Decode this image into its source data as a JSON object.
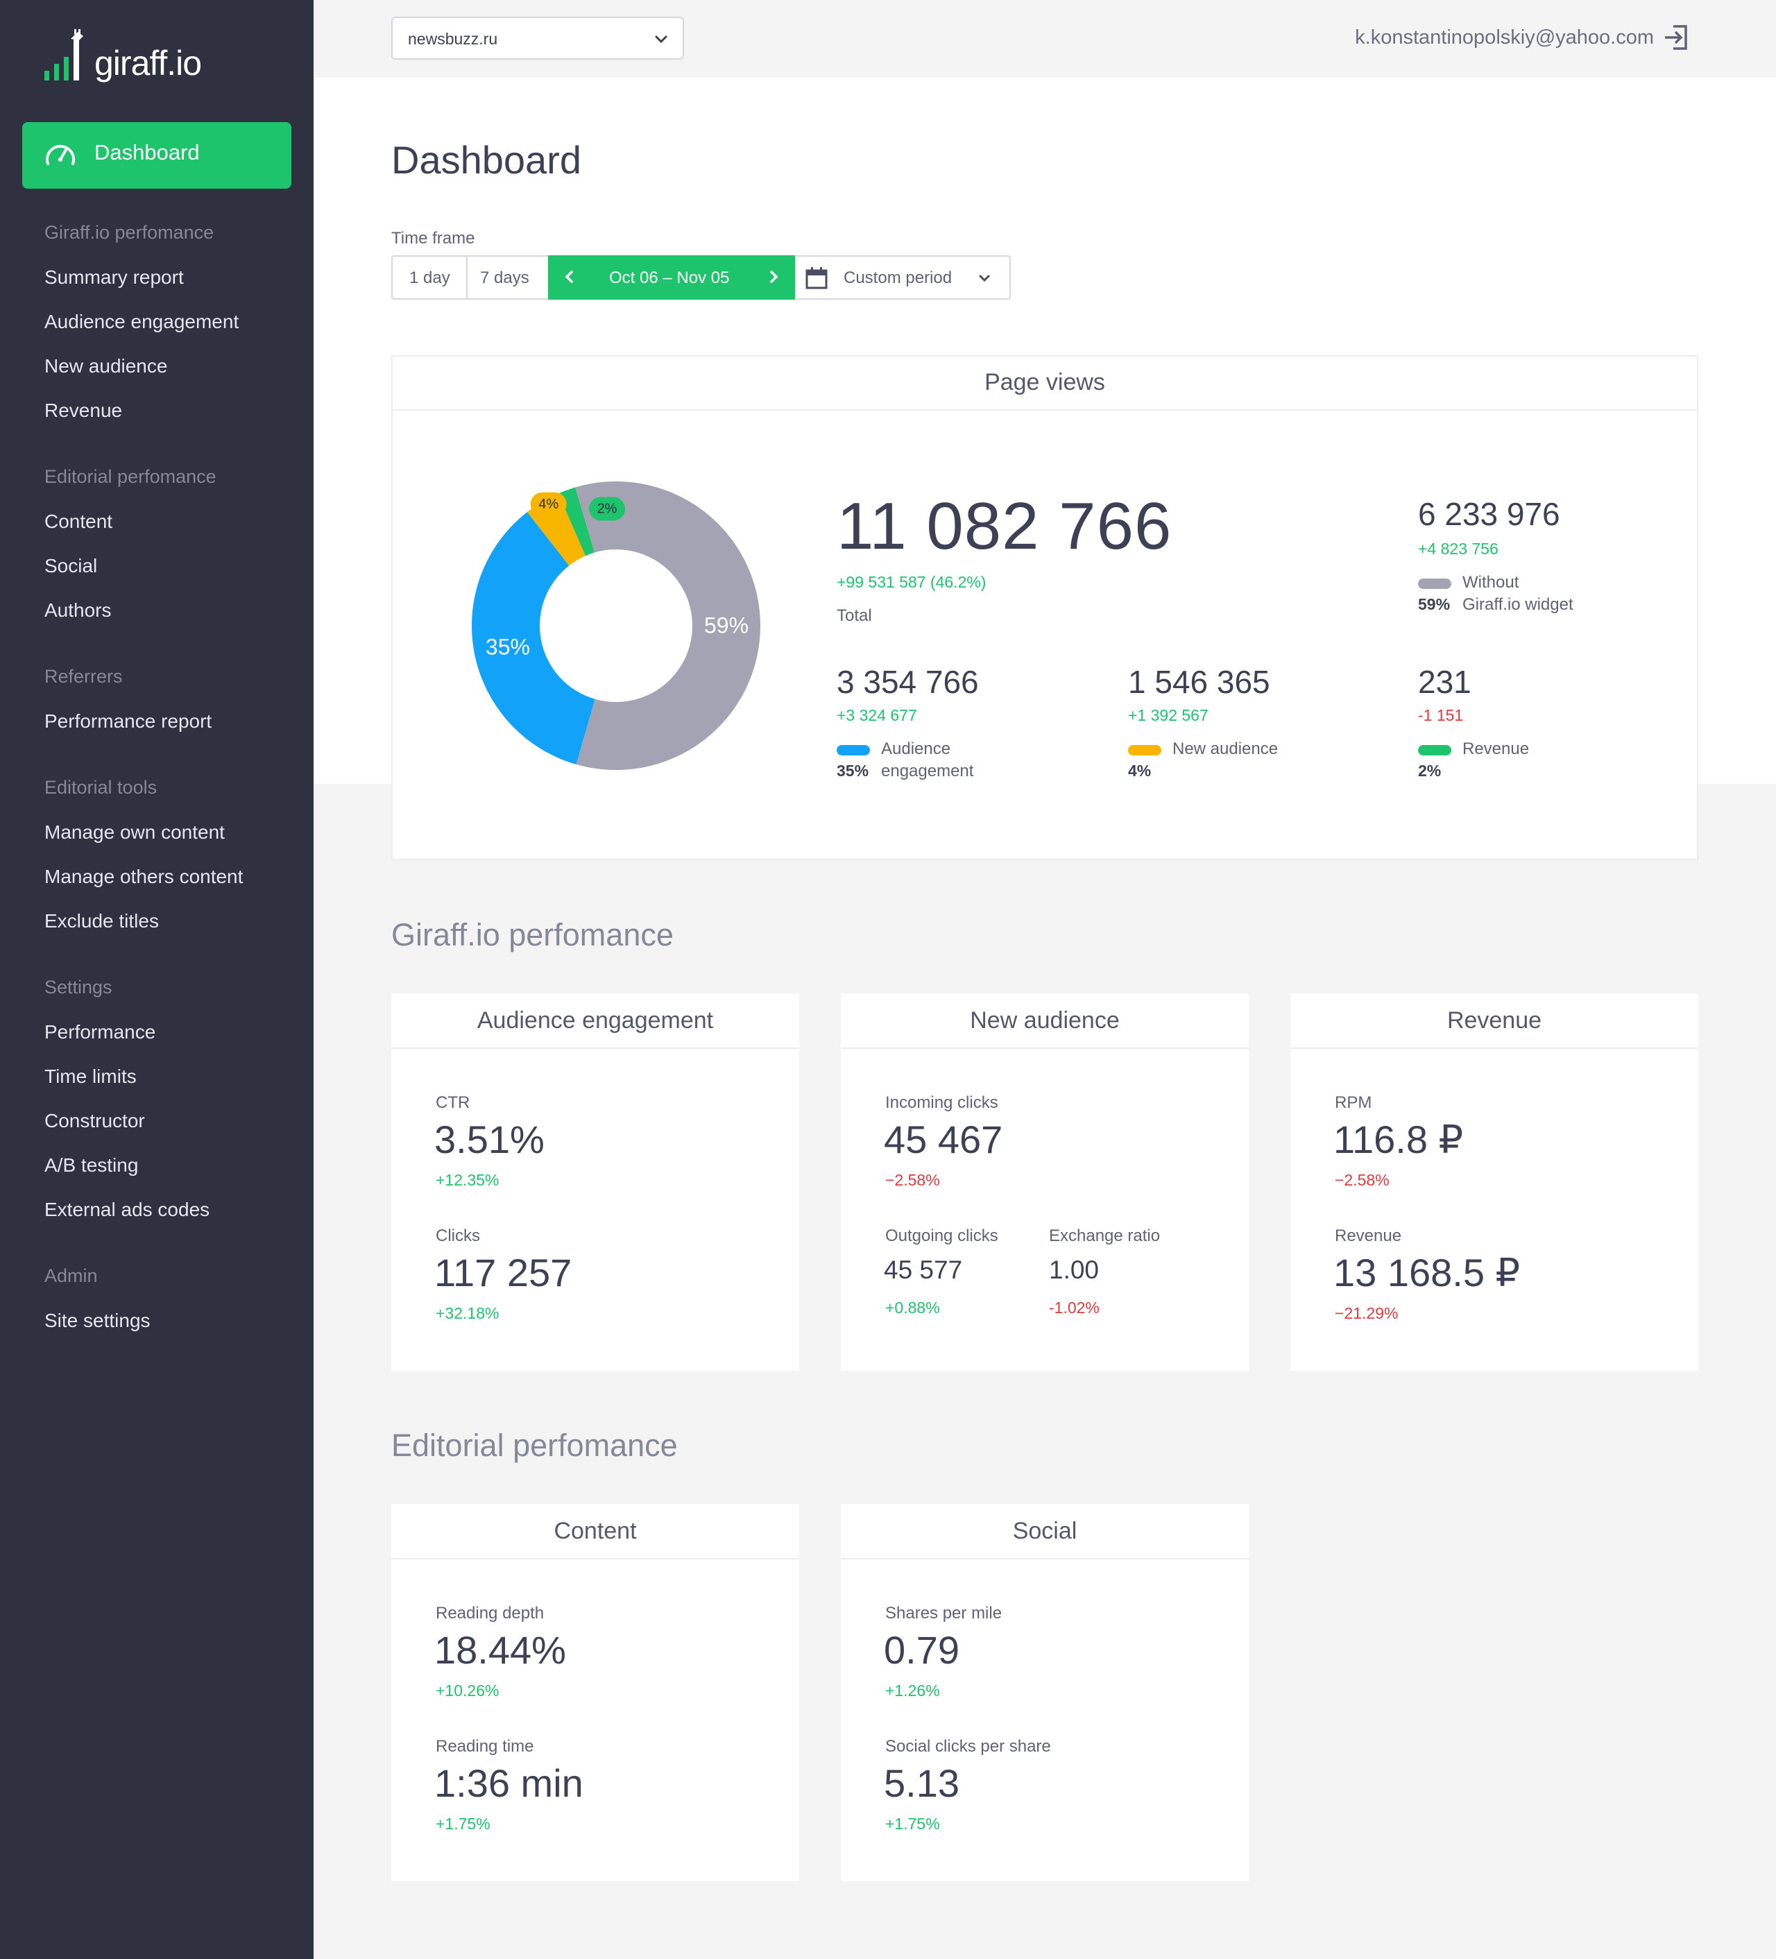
{
  "brand": {
    "name": "giraff.io"
  },
  "sidebar": {
    "dashboard_label": "Dashboard",
    "sections": [
      {
        "title": "Giraff.io perfomance",
        "items": [
          "Summary report",
          "Audience engagement",
          "New audience",
          "Revenue"
        ]
      },
      {
        "title": "Editorial perfomance",
        "items": [
          "Content",
          "Social",
          "Authors"
        ]
      },
      {
        "title": "Referrers",
        "items": [
          "Performance report"
        ]
      },
      {
        "title": "Editorial tools",
        "items": [
          "Manage own content",
          "Manage others content",
          "Exclude titles"
        ]
      },
      {
        "title": "Settings",
        "items": [
          "Performance",
          "Time limits",
          "Constructor",
          "A/B testing",
          "External ads codes"
        ]
      },
      {
        "title": "Admin",
        "items": [
          "Site settings"
        ]
      }
    ]
  },
  "topbar": {
    "site_select": "newsbuzz.ru",
    "user_email": "k.konstantinopolskiy@yahoo.com"
  },
  "page": {
    "title": "Dashboard"
  },
  "timeframe": {
    "label": "Time frame",
    "one_day": "1 day",
    "seven_days": "7 days",
    "range": "Oct 06 – Nov 05",
    "custom": "Custom period"
  },
  "page_views": {
    "title": "Page views",
    "total": "11 082 766",
    "total_delta": "+99 531 587 (46.2%)",
    "total_label": "Total",
    "without": {
      "value": "6 233 976",
      "delta": "+4 823 756",
      "label1": "Without",
      "label2": "Giraff.io widget",
      "pct": "59%"
    },
    "engagement": {
      "value": "3 354 766",
      "delta": "+3 324 677",
      "label1": "Audience",
      "label2": "engagement",
      "pct": "35%"
    },
    "new_audience": {
      "value": "1 546 365",
      "delta": "+1 392 567",
      "label1": "New audience",
      "pct": "4%"
    },
    "revenue": {
      "value": "231",
      "delta": "-1 151",
      "label1": "Revenue",
      "pct": "2%"
    }
  },
  "chart_data": {
    "type": "pie",
    "categories": [
      "Audience engagement",
      "New audience",
      "Revenue",
      "Without Giraff.io widget"
    ],
    "values": [
      35,
      4,
      2,
      59
    ],
    "labels": [
      "35%",
      "4%",
      "2%",
      "59%"
    ],
    "colors": [
      "#12a2f7",
      "#f7b500",
      "#1ec46c",
      "#a3a3b3"
    ]
  },
  "sections": {
    "giraff_title": "Giraff.io perfomance",
    "editorial_title": "Editorial perfomance"
  },
  "cards": {
    "audience": {
      "title": "Audience engagement",
      "m1_label": "CTR",
      "m1_value": "3.51%",
      "m1_delta": "+12.35%",
      "m2_label": "Clicks",
      "m2_value": "117 257",
      "m2_delta": "+32.18%"
    },
    "new_audience": {
      "title": "New audience",
      "m1_label": "Incoming clicks",
      "m1_value": "45 467",
      "m1_delta": "−2.58%",
      "m2_label": "Outgoing clicks",
      "m2_value": "45 577",
      "m2_delta": "+0.88%",
      "m3_label": "Exchange ratio",
      "m3_value": "1.00",
      "m3_delta": "-1.02%"
    },
    "revenue": {
      "title": "Revenue",
      "m1_label": "RPM",
      "m1_value": "116.8 ₽",
      "m1_delta": "−2.58%",
      "m2_label": "Revenue",
      "m2_value": "13 168.5 ₽",
      "m2_delta": "−21.29%"
    },
    "content": {
      "title": "Content",
      "m1_label": "Reading depth",
      "m1_value": "18.44%",
      "m1_delta": "+10.26%",
      "m2_label": "Reading time",
      "m2_value": "1:36 min",
      "m2_delta": "+1.75%"
    },
    "social": {
      "title": "Social",
      "m1_label": "Shares per mile",
      "m1_value": "0.79",
      "m1_delta": "+1.26%",
      "m2_label": "Social clicks per share",
      "m2_value": "5.13",
      "m2_delta": "+1.75%"
    }
  }
}
